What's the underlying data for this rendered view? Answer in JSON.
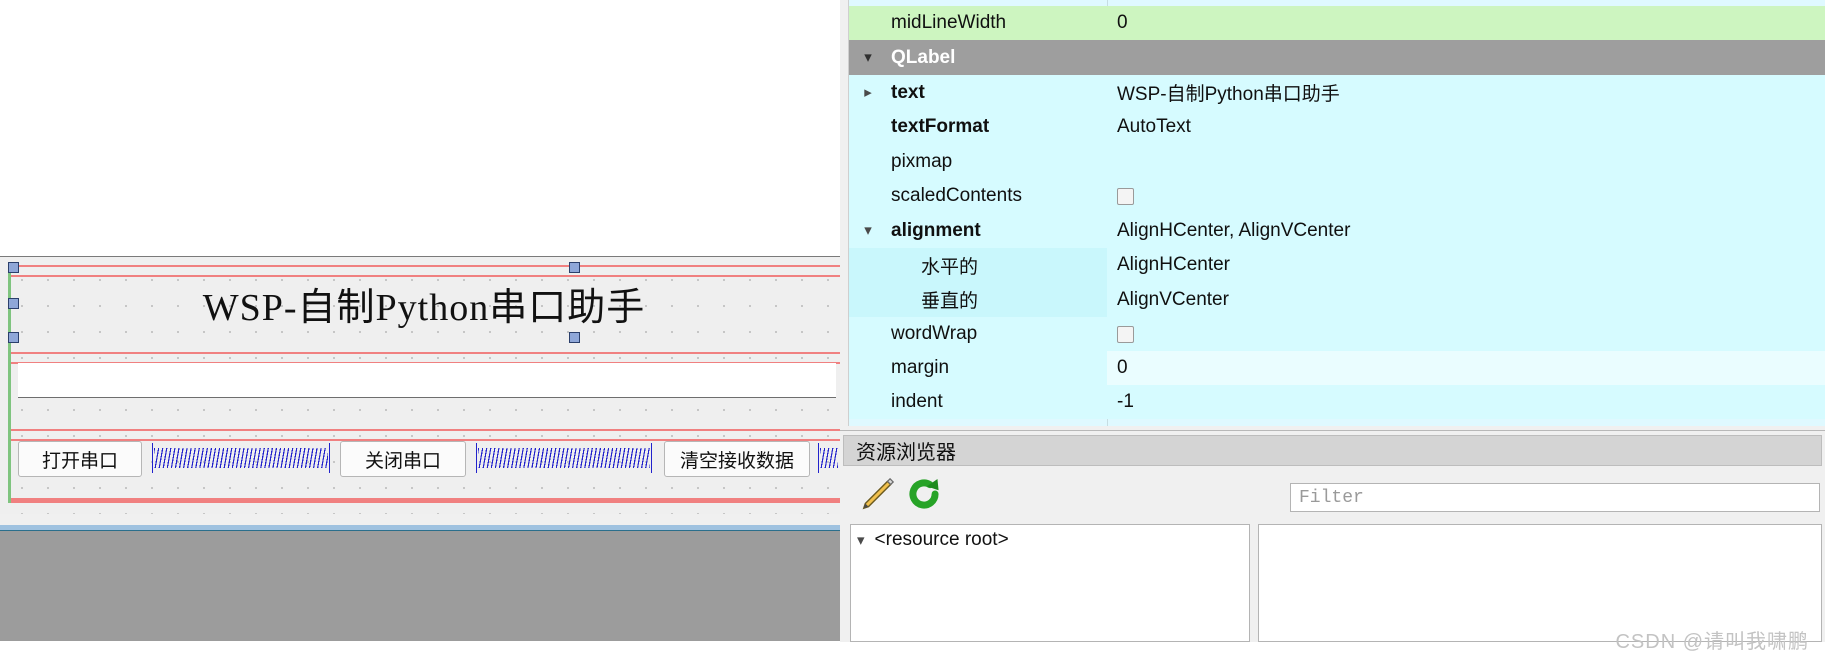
{
  "designer": {
    "label_text": "WSP-自制Python串口助手",
    "line_edit_value": "",
    "buttons": [
      {
        "label": "打开串口"
      },
      {
        "label": "关闭串口"
      },
      {
        "label": "清空接收数据"
      }
    ]
  },
  "property_editor": {
    "rows": [
      {
        "gutter": "",
        "name": "midLineWidth",
        "value": "0",
        "bg": "#cdf5c0",
        "name_bg": "#cdf5c0",
        "bold": false,
        "indent": 0,
        "kind": "normal"
      },
      {
        "gutter": "chevron-down",
        "name": "QLabel",
        "value": "",
        "bg": "#9e9e9e",
        "name_bg": "#9e9e9e",
        "bold": true,
        "indent": 0,
        "kind": "group"
      },
      {
        "gutter": "chevron-right",
        "name": "text",
        "value": "WSP-自制Python串口助手",
        "bg": "#d6fbff",
        "name_bg": "#d6fbff",
        "bold": true,
        "indent": 0,
        "kind": "normal"
      },
      {
        "gutter": "",
        "name": "textFormat",
        "value": "AutoText",
        "bg": "#d6fbff",
        "name_bg": "#d6fbff",
        "bold": true,
        "indent": 0,
        "kind": "normal"
      },
      {
        "gutter": "",
        "name": "pixmap",
        "value": "",
        "bg": "#d6fbff",
        "name_bg": "#d6fbff",
        "bold": false,
        "indent": 0,
        "kind": "normal"
      },
      {
        "gutter": "",
        "name": "scaledContents",
        "value": "",
        "bg": "#d6fbff",
        "name_bg": "#d6fbff",
        "bold": false,
        "indent": 0,
        "kind": "checkbox"
      },
      {
        "gutter": "chevron-down",
        "name": "alignment",
        "value": "AlignHCenter, AlignVCenter",
        "bg": "#d6fbff",
        "name_bg": "#d6fbff",
        "bold": true,
        "indent": 0,
        "kind": "normal"
      },
      {
        "gutter": "",
        "name": "水平的",
        "value": "AlignHCenter",
        "bg": "#d6fbff",
        "name_bg": "#c9f7fc",
        "bold": false,
        "indent": 30,
        "kind": "normal"
      },
      {
        "gutter": "",
        "name": "垂直的",
        "value": "AlignVCenter",
        "bg": "#d6fbff",
        "name_bg": "#c9f7fc",
        "bold": false,
        "indent": 30,
        "kind": "normal"
      },
      {
        "gutter": "",
        "name": "wordWrap",
        "value": "",
        "bg": "#d6fbff",
        "name_bg": "#d6fbff",
        "bold": false,
        "indent": 0,
        "kind": "checkbox"
      },
      {
        "gutter": "",
        "name": "margin",
        "value": "0",
        "bg": "#eafdff",
        "name_bg": "#d6fbff",
        "bold": false,
        "indent": 0,
        "kind": "normal"
      },
      {
        "gutter": "",
        "name": "indent",
        "value": "-1",
        "bg": "#d6fbff",
        "name_bg": "#d6fbff",
        "bold": false,
        "indent": 0,
        "kind": "normal"
      }
    ]
  },
  "resource_browser": {
    "title": "资源浏览器",
    "edit_icon": "pencil-icon",
    "reload_icon": "refresh-icon",
    "filter_placeholder": "Filter",
    "filter_value": "",
    "tree_root_label": "<resource root>"
  },
  "watermark": "CSDN @请叫我啸鹏",
  "colors": {
    "highlight_red": "#ff0000",
    "row_cyan": "#d6fbff",
    "row_green": "#cdf5c0",
    "group_gray": "#9e9e9e",
    "layout_red": "#f08080",
    "spring_blue": "#2222cc"
  }
}
